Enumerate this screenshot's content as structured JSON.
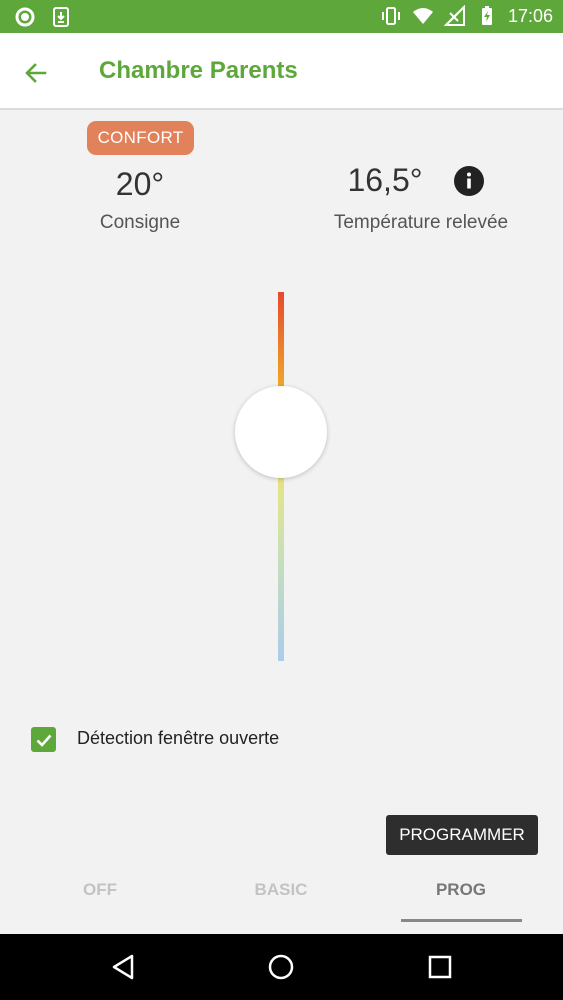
{
  "status_bar": {
    "time": "17:06",
    "icons": [
      "circle-notification-icon",
      "download-notification-icon",
      "vibrate-icon",
      "wifi-icon",
      "no-signal-icon",
      "battery-charging-icon"
    ]
  },
  "app_bar": {
    "title": "Chambre Parents",
    "back_icon": "arrow-left-icon"
  },
  "setpoint": {
    "mode_badge": "CONFORT",
    "value": "20°",
    "label": "Consigne"
  },
  "measured": {
    "value": "16,5°",
    "label": "Température relevée",
    "info_icon": "info-icon"
  },
  "slider": {
    "position_fraction": 0.38
  },
  "window_detection": {
    "label": "Détection fenêtre ouverte",
    "checked": true
  },
  "program_button": {
    "label": "PROGRAMMER"
  },
  "tabs": [
    {
      "label": "OFF",
      "active": false
    },
    {
      "label": "BASIC",
      "active": false
    },
    {
      "label": "PROG",
      "active": true
    }
  ],
  "nav_bar": {
    "icons": [
      "nav-back-icon",
      "nav-home-icon",
      "nav-recents-icon"
    ]
  },
  "colors": {
    "primary": "#5ea83b",
    "badge": "#e2825a",
    "button_dark": "#2e2e2e"
  }
}
